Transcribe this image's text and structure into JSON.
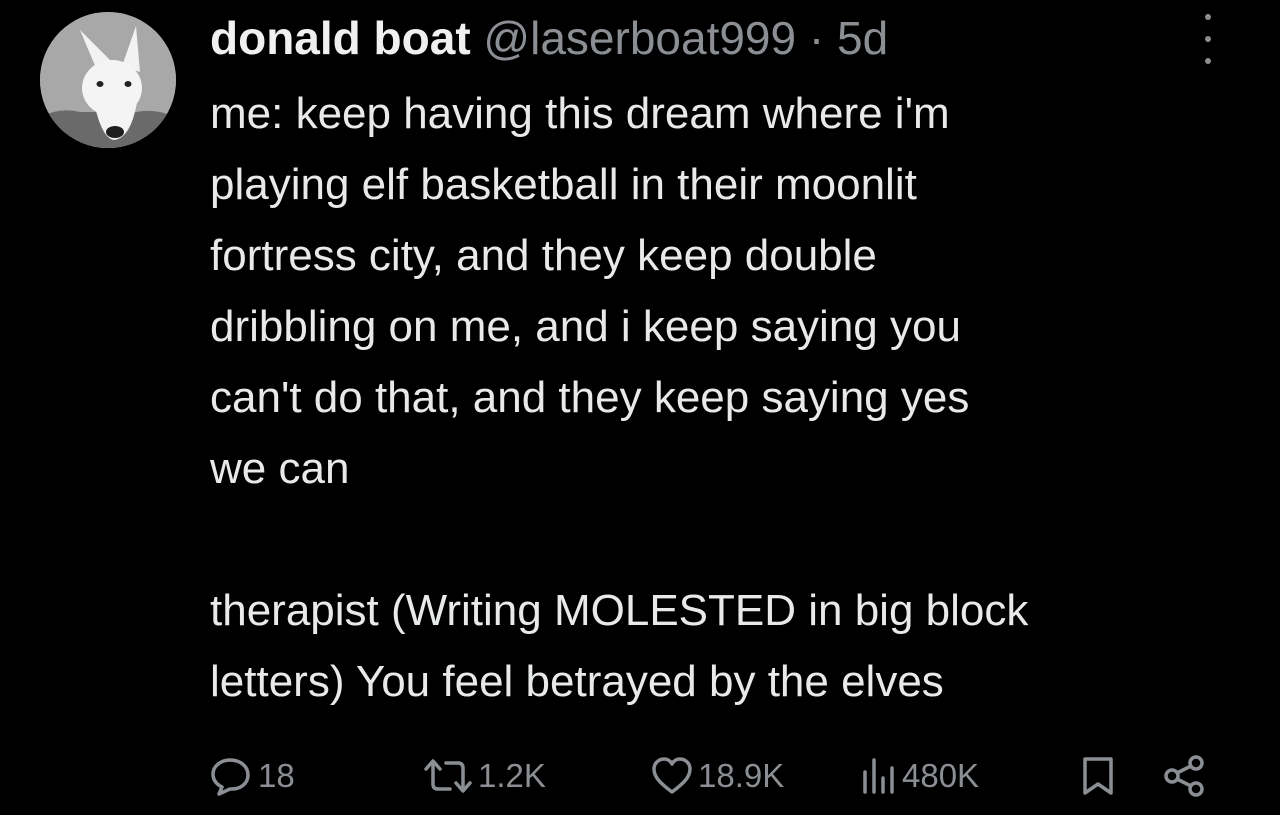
{
  "tweet": {
    "author_name": "donald boat",
    "handle": "@laserboat999",
    "separator": "·",
    "time": "5d",
    "lines": [
      "me: keep having this dream where i'm",
      "playing elf basketball in their moonlit",
      "fortress city, and they keep double",
      "dribbling on me, and i keep saying you",
      "can't do that, and they keep saying yes",
      "we can"
    ],
    "lines2": [
      "therapist (Writing MOLESTED in big block",
      "letters) You feel betrayed by the elves"
    ]
  },
  "actions": {
    "replies": "18",
    "retweets": "1.2K",
    "likes": "18.9K",
    "views": "480K"
  },
  "icons": [
    "avatar-dog",
    "more-icon",
    "reply-icon",
    "retweet-icon",
    "like-icon",
    "views-icon",
    "bookmark-icon",
    "share-icon"
  ]
}
